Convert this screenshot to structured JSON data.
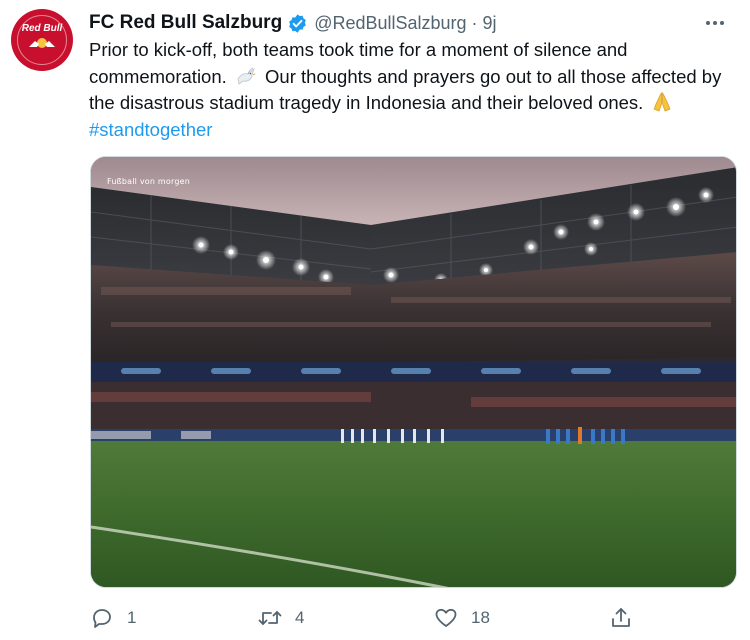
{
  "author": {
    "name": "FC Red Bull Salzburg",
    "handle": "@RedBullSalzburg",
    "separator": "·",
    "time": "9j",
    "avatar_text": "Red Bull"
  },
  "tweet": {
    "text_part1": "Prior to kick-off, both teams took time for a moment of silence and commemoration.",
    "text_part2": "Our thoughts and prayers go out to all those affected by the disastrous stadium tragedy in Indonesia and their beloved ones.",
    "hashtag": "#standtogether"
  },
  "media": {
    "watermark": "Fußball von morgen"
  },
  "actions": {
    "reply_count": "1",
    "retweet_count": "4",
    "like_count": "18"
  },
  "icons": {
    "verified": "verified-badge-icon",
    "more": "more-options-icon",
    "reply": "reply-icon",
    "retweet": "retweet-icon",
    "like": "heart-icon",
    "share": "share-icon",
    "dove": "dove-emoji",
    "pray": "praying-hands-emoji"
  },
  "colors": {
    "brand_red": "#c8102e",
    "link_blue": "#1d9bf0",
    "secondary_text": "#536471",
    "primary_text": "#0f1419"
  }
}
